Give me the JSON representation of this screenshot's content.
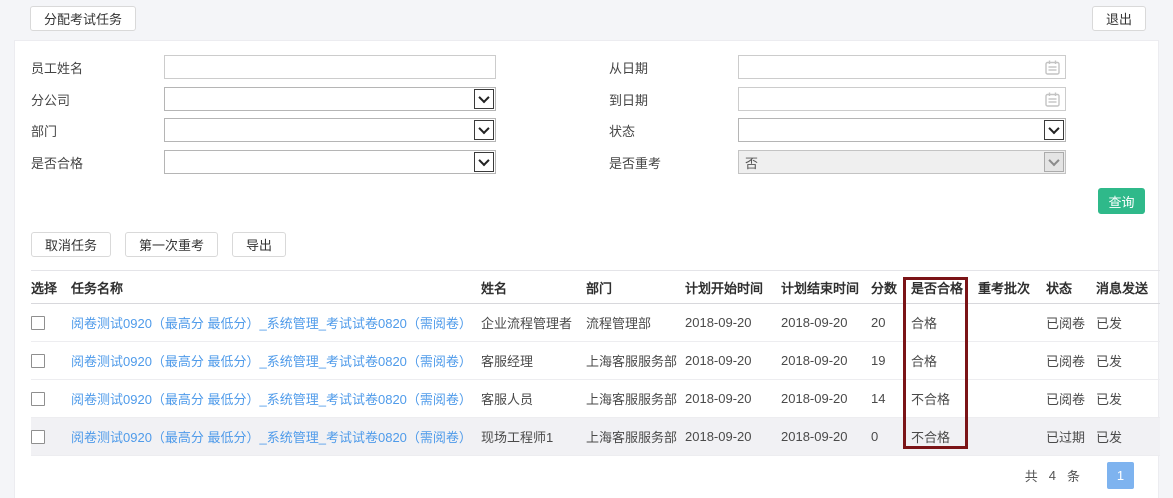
{
  "colors": {
    "accent_green": "#2fb98a",
    "link_blue": "#4f9bea",
    "page_button_blue": "#7eb3ef",
    "annotation_red": "#7b1417",
    "highlighted_row_bg": "#f1f1f4"
  },
  "icons": {
    "date_picker": "calendar-icon",
    "select_arrow": "chevron-down-icon"
  },
  "top_bar": {
    "assign_button": "分配考试任务",
    "logout_button": "退出"
  },
  "filters": {
    "left": [
      {
        "label": "员工姓名",
        "type": "text",
        "value": ""
      },
      {
        "label": "分公司",
        "type": "select",
        "value": ""
      },
      {
        "label": "部门",
        "type": "select",
        "value": ""
      },
      {
        "label": "是否合格",
        "type": "select",
        "value": ""
      }
    ],
    "right": [
      {
        "label": "从日期",
        "type": "date",
        "value": ""
      },
      {
        "label": "到日期",
        "type": "date",
        "value": ""
      },
      {
        "label": "状态",
        "type": "select",
        "value": ""
      },
      {
        "label": "是否重考",
        "type": "select",
        "value": "否",
        "disabled": true
      }
    ],
    "search_button": "查询"
  },
  "toolbar": {
    "cancel_task": "取消任务",
    "first_retake": "第一次重考",
    "export": "导出"
  },
  "table": {
    "headers": [
      "选择",
      "任务名称",
      "姓名",
      "部门",
      "计划开始时间",
      "计划结束时间",
      "分数",
      "是否合格",
      "重考批次",
      "状态",
      "消息发送"
    ],
    "rows": [
      {
        "task": "阅卷测试0920（最高分 最低分）_系统管理_考试试卷0820（需阅卷）",
        "name": "企业流程管理者",
        "dept": "流程管理部",
        "start": "2018-09-20",
        "end": "2018-09-20",
        "score": "20",
        "pass": "合格",
        "retake": "",
        "status": "已阅卷",
        "msg": "已发",
        "highlighted": false
      },
      {
        "task": "阅卷测试0920（最高分 最低分）_系统管理_考试试卷0820（需阅卷）",
        "name": "客服经理",
        "dept": "上海客服服务部",
        "start": "2018-09-20",
        "end": "2018-09-20",
        "score": "19",
        "pass": "合格",
        "retake": "",
        "status": "已阅卷",
        "msg": "已发",
        "highlighted": false
      },
      {
        "task": "阅卷测试0920（最高分 最低分）_系统管理_考试试卷0820（需阅卷）",
        "name": "客服人员",
        "dept": "上海客服服务部",
        "start": "2018-09-20",
        "end": "2018-09-20",
        "score": "14",
        "pass": "不合格",
        "retake": "",
        "status": "已阅卷",
        "msg": "已发",
        "highlighted": false
      },
      {
        "task": "阅卷测试0920（最高分 最低分）_系统管理_考试试卷0820（需阅卷）",
        "name": "现场工程师1",
        "dept": "上海客服服务部",
        "start": "2018-09-20",
        "end": "2018-09-20",
        "score": "0",
        "pass": "不合格",
        "retake": "",
        "status": "已过期",
        "msg": "已发",
        "highlighted": true
      }
    ]
  },
  "pagination": {
    "total_prefix": "共",
    "total_count": "4",
    "total_suffix": "条",
    "current_page": "1"
  }
}
